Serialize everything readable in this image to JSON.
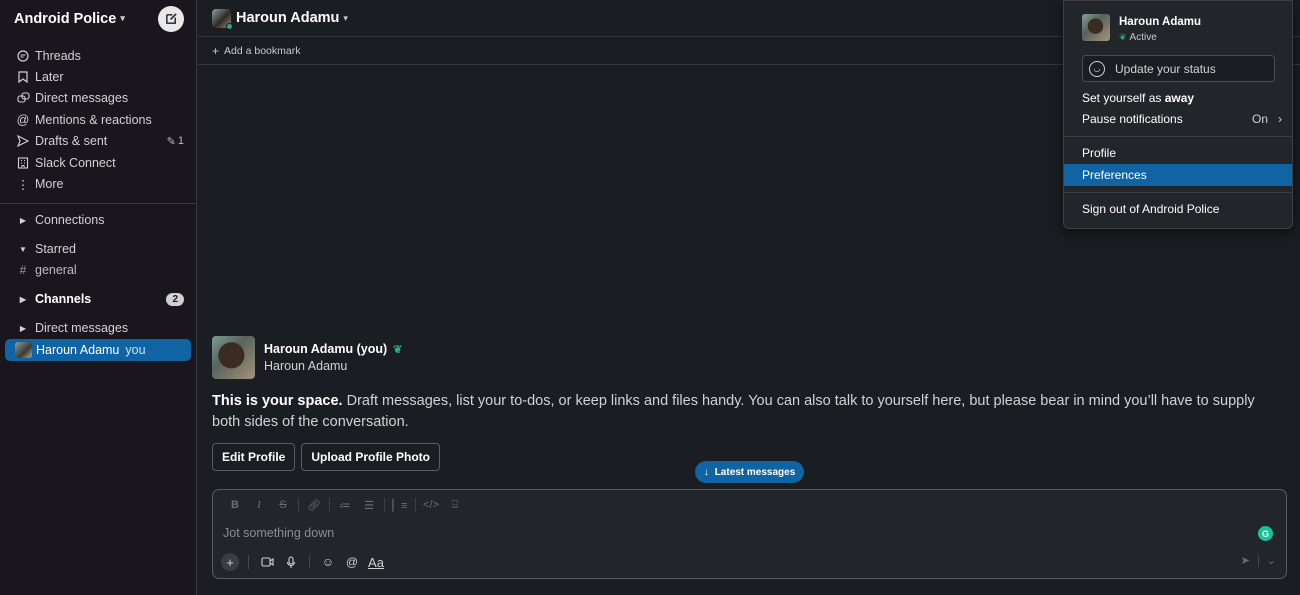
{
  "workspace": {
    "name": "Android Police",
    "chevron": "⌄"
  },
  "sidebar": {
    "nav": [
      {
        "label": "Threads",
        "icon": "threads-icon"
      },
      {
        "label": "Later",
        "icon": "bookmark-icon"
      },
      {
        "label": "Direct messages",
        "icon": "dm-icon"
      },
      {
        "label": "Mentions & reactions",
        "icon": "at-icon"
      },
      {
        "label": "Drafts & sent",
        "icon": "send-icon",
        "trail": "1"
      },
      {
        "label": "Slack Connect",
        "icon": "building-icon"
      },
      {
        "label": "More",
        "icon": "more-icon"
      }
    ],
    "sections": {
      "connections": "Connections",
      "starred": "Starred",
      "general": "general",
      "channels": "Channels",
      "channels_badge": "2",
      "dms": "Direct messages",
      "dm_user": "Haroun Adamu",
      "dm_you": "you"
    }
  },
  "header": {
    "title": "Haroun Adamu",
    "bookmark": "Add a bookmark"
  },
  "intro": {
    "name": "Haroun Adamu (you)",
    "subname": "Haroun Adamu",
    "lead": "This is your space.",
    "body": " Draft messages, list your to-dos, or keep links and files handy. You can also talk to yourself here, but please bear in mind you’ll have to supply both sides of the conversation.",
    "edit_profile": "Edit Profile",
    "upload_photo": "Upload Profile Photo"
  },
  "latest_messages": "Latest messages",
  "composer": {
    "placeholder": "Jot something down",
    "grammarly": "G",
    "text_tool": "Aa"
  },
  "menu": {
    "name": "Haroun Adamu",
    "status": "Active",
    "update_status": "Update your status",
    "away_prefix": "Set yourself as ",
    "away_bold": "away",
    "pause": "Pause notifications",
    "pause_value": "On",
    "profile": "Profile",
    "preferences": "Preferences",
    "signout": "Sign out of Android Police"
  },
  "colors": {
    "accent": "#1164a3",
    "active_green": "#2bac76",
    "background": "#1a1d21",
    "sidebar": "#19171d"
  }
}
